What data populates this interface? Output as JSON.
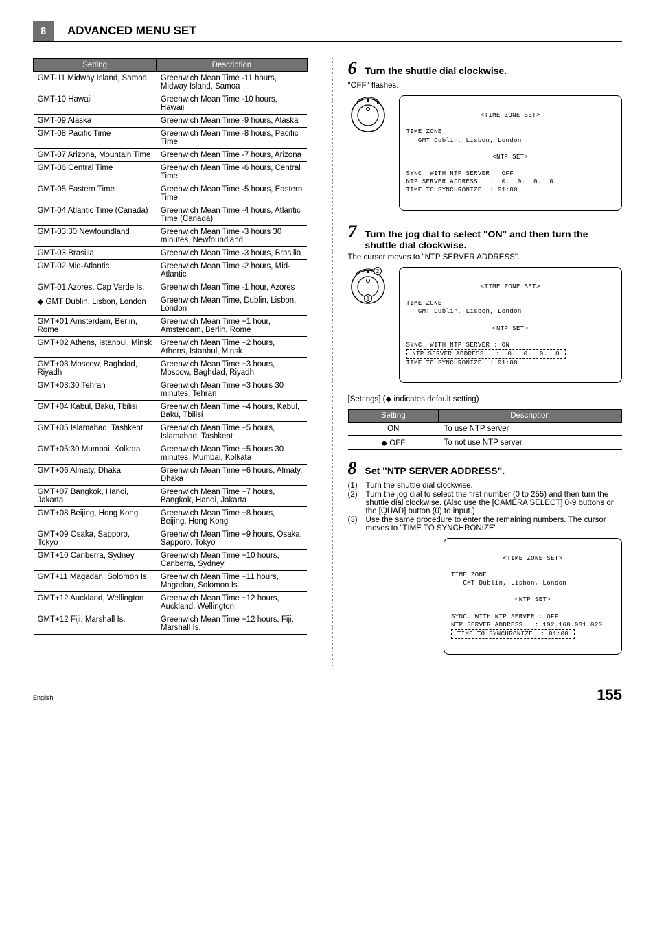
{
  "header": {
    "section_number": "8",
    "title": "ADVANCED MENU SET"
  },
  "tz_table": {
    "head": [
      "Setting",
      "Description"
    ],
    "rows": [
      [
        "GMT-11 Midway Island, Samoa",
        "Greenwich Mean Time -11 hours, Midway Island, Samoa"
      ],
      [
        "GMT-10 Hawaii",
        "Greenwich Mean Time -10 hours, Hawaii"
      ],
      [
        "GMT-09 Alaska",
        "Greenwich Mean Time -9 hours, Alaska"
      ],
      [
        "GMT-08 Pacific Time",
        "Greenwich Mean Time -8 hours, Pacific Time"
      ],
      [
        "GMT-07 Arizona, Mountain Time",
        "Greenwich Mean Time -7 hours, Arizona"
      ],
      [
        "GMT-06 Central Time",
        "Greenwich Mean Time -6 hours, Central Time"
      ],
      [
        "GMT-05 Eastern Time",
        "Greenwich Mean Time -5 hours, Eastern Time"
      ],
      [
        "GMT-04 Atlantic Time (Canada)",
        "Greenwich Mean Time -4 hours, Atlantic Time (Canada)"
      ],
      [
        "GMT-03:30 Newfoundland",
        "Greenwich Mean Time -3 hours 30 minutes, Newfoundland"
      ],
      [
        "GMT-03 Brasilia",
        "Greenwich Mean Time -3 hours, Brasilia"
      ],
      [
        "GMT-02 Mid-Atlantic",
        "Greenwich Mean Time -2 hours, Mid-Atlantic"
      ],
      [
        "GMT-01 Azores, Cap Verde Is.",
        "Greenwich Mean Time -1 hour, Azores"
      ],
      [
        "◆ GMT Dublin, Lisbon, London",
        "Greenwich Mean Time, Dublin, Lisbon, London"
      ],
      [
        "GMT+01 Amsterdam, Berlin, Rome",
        "Greenwich Mean Time +1 hour, Amsterdam, Berlin, Rome"
      ],
      [
        "GMT+02 Athens, Istanbul, Minsk",
        "Greenwich Mean Time +2 hours, Athens, Istanbul, Minsk"
      ],
      [
        "GMT+03 Moscow, Baghdad, Riyadh",
        "Greenwich Mean Time +3 hours, Moscow, Baghdad, Riyadh"
      ],
      [
        "GMT+03:30 Tehran",
        "Greenwich Mean Time +3 hours 30 minutes, Tehran"
      ],
      [
        "GMT+04 Kabul, Baku, Tbilisi",
        "Greenwich Mean Time +4 hours, Kabul, Baku, Tbilisi"
      ],
      [
        "GMT+05 Islamabad, Tashkent",
        "Greenwich Mean Time +5 hours, Islamabad, Tashkent"
      ],
      [
        "GMT+05:30 Mumbai, Kolkata",
        "Greenwich Mean Time +5 hours 30 minutes, Mumbai, Kolkata"
      ],
      [
        "GMT+06 Almaty, Dhaka",
        "Greenwich Mean Time +6 hours, Almaty, Dhaka"
      ],
      [
        "GMT+07 Bangkok, Hanoi, Jakarta",
        "Greenwich Mean Time +7 hours, Bangkok, Hanoi, Jakarta"
      ],
      [
        "GMT+08 Beijing, Hong Kong",
        "Greenwich Mean Time +8 hours, Beijing, Hong Kong"
      ],
      [
        "GMT+09 Osaka, Sapporo, Tokyo",
        "Greenwich Mean Time +9 hours, Osaka, Sapporo, Tokyo"
      ],
      [
        "GMT+10 Canberra, Sydney",
        "Greenwich Mean Time +10 hours, Canberra, Sydney"
      ],
      [
        "GMT+11 Magadan, Solomon Is.",
        "Greenwich Mean Time +11 hours, Magadan, Solomon Is."
      ],
      [
        "GMT+12 Auckland, Wellington",
        "Greenwich Mean Time +12 hours, Auckland, Wellington"
      ],
      [
        "GMT+12 Fiji, Marshall Is.",
        "Greenwich Mean Time +12 hours, Fiji, Marshall Is."
      ]
    ]
  },
  "step6": {
    "num": "6",
    "title": "Turn the shuttle dial clockwise.",
    "sub": "\"OFF\" flashes.",
    "osd": {
      "title": "<TIME ZONE SET>",
      "l1": "TIME ZONE",
      "l2": "   GMT Dublin, Lisbon, London",
      "sub": "<NTP SET>",
      "l3": "SYNC. WITH NTP SERVER   OFF",
      "l4": "NTP SERVER ADDRESS   :  0.  0.  0.  0",
      "l5": "TIME TO SYNCHRONIZE  : 01:00"
    }
  },
  "step7": {
    "num": "7",
    "title": "Turn the jog dial to select \"ON\" and then turn the shuttle dial clockwise.",
    "sub": "The cursor moves to \"NTP SERVER ADDRESS\".",
    "osd": {
      "title": "<TIME ZONE SET>",
      "l1": "TIME ZONE",
      "l2": "   GMT Dublin, Lisbon, London",
      "sub": "<NTP SET>",
      "l3": "SYNC. WITH NTP SERVER : ON",
      "l4": " NTP SERVER ADDRESS   :  0.  0.  0.  0 ",
      "l5": "TIME TO SYNCHRONIZE  : 01:00"
    },
    "settings_label": "[Settings] (◆ indicates default setting)",
    "table": {
      "head": [
        "Setting",
        "Description"
      ],
      "rows": [
        [
          "ON",
          "To use NTP server"
        ],
        [
          "◆ OFF",
          "To not use NTP server"
        ]
      ]
    }
  },
  "step8": {
    "num": "8",
    "title": "Set \"NTP SERVER ADDRESS\".",
    "items": [
      {
        "n": "(1)",
        "t": "Turn the shuttle dial clockwise."
      },
      {
        "n": "(2)",
        "t": "Turn the jog dial to select the first number (0 to 255) and then turn the shuttle dial clockwise.  (Also use the [CAMERA SELECT] 0-9 buttons or the [QUAD] button (0) to input.)"
      },
      {
        "n": "(3)",
        "t": "Use the same procedure to enter the remaining numbers. The cursor moves to \"TIME TO SYNCHRONIZE\"."
      }
    ],
    "osd": {
      "title": "<TIME ZONE SET>",
      "l1": "TIME ZONE",
      "l2": "   GMT Dublin, Lisbon, London",
      "sub": "<NTP SET>",
      "l3": "SYNC. WITH NTP SERVER : OFF",
      "l4": "NTP SERVER ADDRESS   : 192.168.001.020",
      "l5": " TIME TO SYNCHRONIZE  : 01:00 "
    }
  },
  "footer": {
    "lang": "English",
    "page": "155"
  }
}
